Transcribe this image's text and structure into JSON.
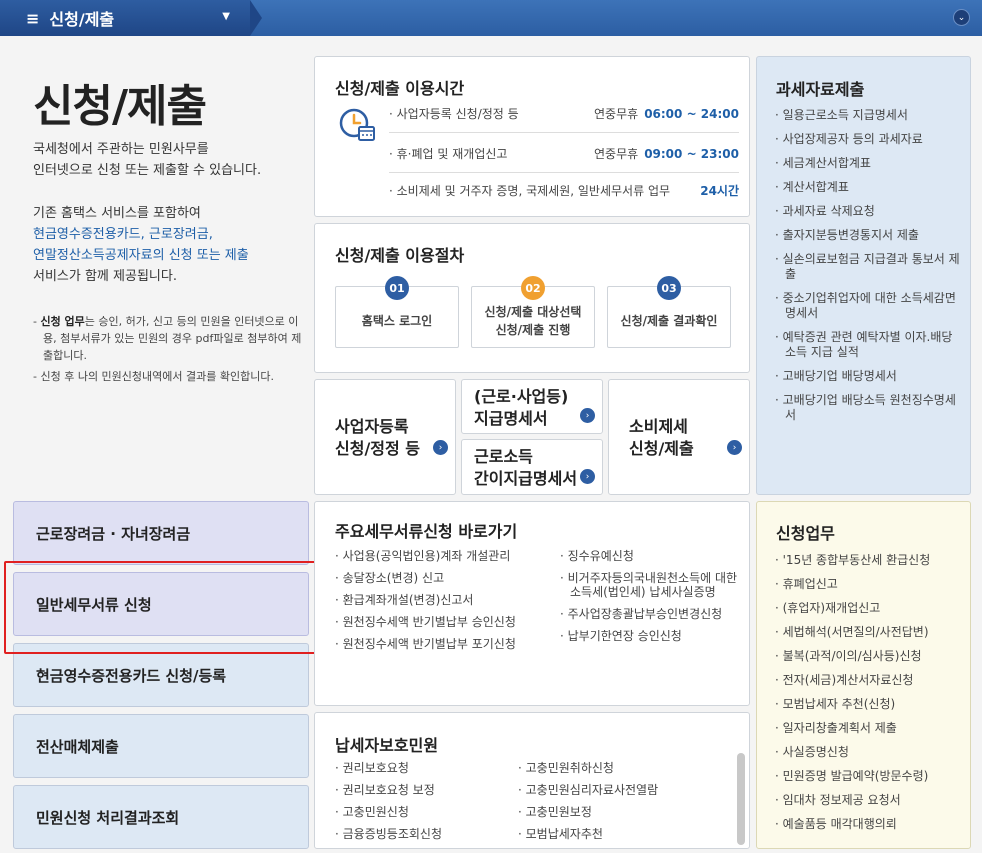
{
  "topbar": {
    "menu_icon": "≡",
    "dropdown_label": "신청/제출",
    "caret": "▼",
    "right_icon": "⌄"
  },
  "intro": {
    "title": "신청/제출",
    "desc1_line1": "국세청에서 주관하는 민원사무를",
    "desc1_line2": "인터넷으로 신청 또는 제출할 수 있습니다.",
    "desc2_line1": "기존 홈택스 서비스를 포함하여",
    "desc2_blue1": "현금영수증전용카드, 근로장려금,",
    "desc2_blue2": "연말정산소득공제자료의 신청 또는 제출",
    "desc2_line4": "서비스가 함께 제공됩니다.",
    "note1_bold": "신청 업무",
    "note1_text": "는 승인, 허가, 신고 등의 민원을 인터넷으로 이용, 첨부서류가 있는 민원의 경우 pdf파일로 첨부하여 제출합니다.",
    "note2": "신청 후 나의 민원신청내역에서 결과를 확인합니다."
  },
  "usage_time": {
    "title": "신청/제출 이용시간",
    "rows": [
      {
        "label": "· 사업자등록 신청/정정 등",
        "period": "연중무휴",
        "time": "06:00 ~ 24:00"
      },
      {
        "label": "· 휴·폐업 및 재개업신고",
        "period": "연중무휴",
        "time": "09:00 ~ 23:00"
      },
      {
        "label": "· 소비제세 및 거주자 증명, 국제세원, 일반세무서류 업무",
        "period": "",
        "time": "24시간"
      }
    ]
  },
  "procedure": {
    "title": "신청/제출 이용절차",
    "steps": [
      {
        "num": "01",
        "line1": "홈택스 로그인",
        "line2": ""
      },
      {
        "num": "02",
        "line1": "신청/제출 대상선택",
        "line2": "신청/제출 진행"
      },
      {
        "num": "03",
        "line1": "신청/제출 결과확인",
        "line2": ""
      }
    ]
  },
  "links": {
    "biz": {
      "line1": "사업자등록",
      "line2": "신청/정정 등"
    },
    "payment": {
      "line1": "(근로·사업등)",
      "line2": "지급명세서"
    },
    "simple": {
      "line1": "근로소득",
      "line2": "간이지급명세서"
    },
    "consumption": {
      "line1": "소비제세",
      "line2": "신청/제출"
    },
    "go_glyph": "›"
  },
  "tax_data": {
    "title": "과세자료제출",
    "items": [
      "· 일용근로소득 지급명세서",
      "· 사업장제공자 등의 과세자료",
      "· 세금계산서합계표",
      "· 계산서합계표",
      "· 과세자료 삭제요청",
      "· 출자지분등변경통지서 제출",
      "· 실손의료보험금 지급결과 통보서 제출",
      "· 중소기업취업자에 대한 소득세감면명세서",
      "· 예탁증권 관련 예탁자별 이자.배당소득 지급 실적",
      "· 고배당기업 배당명세서",
      "· 고배당기업 배당소득 원천징수명세서"
    ]
  },
  "nav": {
    "items": [
      "근로장려금 · 자녀장려금",
      "일반세무서류 신청",
      "현금영수증전용카드 신청/등록",
      "전산매체제출",
      "민원신청 처리결과조회"
    ]
  },
  "shortcuts": {
    "title": "주요세무서류신청 바로가기",
    "left": [
      "· 사업용(공익법인용)계좌 개설관리",
      "· 송달장소(변경) 신고",
      "· 환급계좌개설(변경)신고서",
      "· 원천징수세액 반기별납부 승인신청",
      "· 원천징수세액 반기별납부 포기신청"
    ],
    "right": [
      "· 징수유예신청",
      "· 비거주자등의국내원천소득에 대한 소득세(법인세) 납세사실증명",
      "· 주사업장총괄납부승인변경신청",
      "· 납부기한연장 승인신청"
    ]
  },
  "protection": {
    "title": "납세자보호민원",
    "left": [
      "· 권리보호요청",
      "· 권리보호요청 보정",
      "· 고충민원신청",
      "· 금융증빙등조회신청"
    ],
    "right": [
      "· 고충민원취하신청",
      "· 고충민원심리자료사전열람",
      "· 고충민원보정",
      "· 모범납세자추천"
    ]
  },
  "application": {
    "title": "신청업무",
    "items": [
      "· '15년 종합부동산세 환급신청",
      "· 휴폐업신고",
      "· (휴업자)재개업신고",
      "· 세법해석(서면질의/사전답변)",
      "· 불복(과적/이의/심사등)신청",
      "· 전자(세금)계산서자료신청",
      "· 모범납세자 추천(신청)",
      "· 일자리창출계획서 제출",
      "· 사실증명신청",
      "· 민원증명 발급예약(방문수령)",
      "· 임대차 정보제공 요청서",
      "· 예술품등 매각대행의뢰"
    ]
  }
}
